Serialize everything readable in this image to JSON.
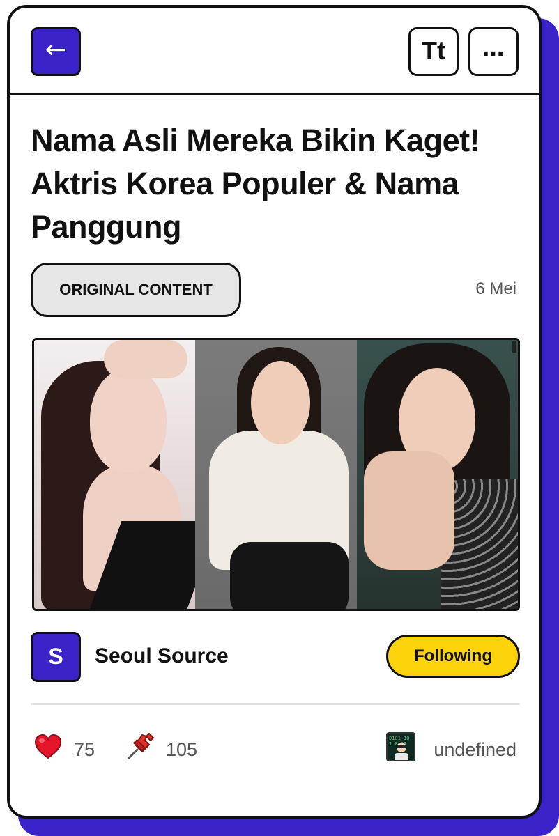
{
  "header": {
    "back_label": "←",
    "text_size_label": "Tt",
    "more_label": "…"
  },
  "article": {
    "title": "Nama Asli Mereka Bikin Kaget! Aktris Korea Populer & Nama Panggung",
    "tag": "ORIGINAL CONTENT",
    "date": "6 Mei"
  },
  "author": {
    "initial": "S",
    "name": "Seoul Source",
    "follow_label": "Following"
  },
  "stats": {
    "likes": "75",
    "pins": "105",
    "badge_label": "undefined"
  },
  "colors": {
    "accent": "#3a22c9",
    "follow": "#fcd20a",
    "heart": "#e5152a",
    "pin": "#e5302a"
  },
  "icons": {
    "heart": "heart-icon",
    "pin": "pushpin-icon",
    "badge": "coder-avatar-icon"
  }
}
